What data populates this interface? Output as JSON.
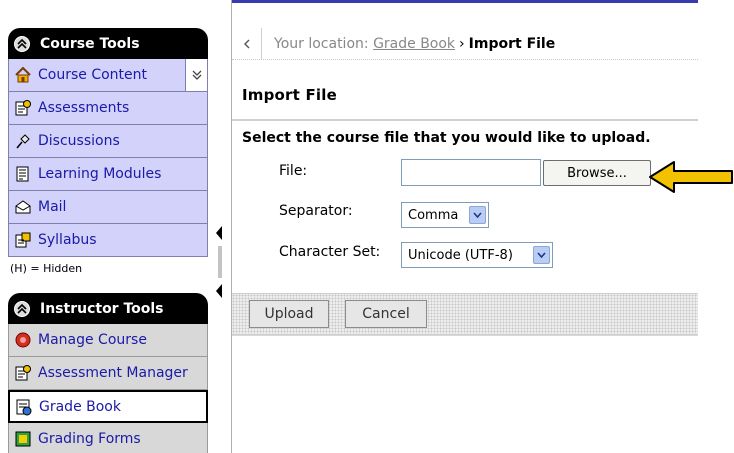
{
  "sidebar": {
    "course_tools": {
      "title": "Course Tools",
      "items": [
        {
          "label": "Course Content",
          "icon": "house-icon"
        },
        {
          "label": "Assessments",
          "icon": "assessments-icon"
        },
        {
          "label": "Discussions",
          "icon": "pushpin-icon"
        },
        {
          "label": "Learning Modules",
          "icon": "document-icon"
        },
        {
          "label": "Mail",
          "icon": "mail-icon"
        },
        {
          "label": "Syllabus",
          "icon": "syllabus-icon"
        }
      ],
      "hidden_note": "(H) = Hidden"
    },
    "instructor_tools": {
      "title": "Instructor Tools",
      "items": [
        {
          "label": "Manage Course",
          "icon": "manage-course-icon"
        },
        {
          "label": "Assessment Manager",
          "icon": "assessments-icon"
        },
        {
          "label": "Grade Book",
          "icon": "grade-book-icon",
          "selected": true
        },
        {
          "label": "Grading Forms",
          "icon": "grading-forms-icon"
        }
      ]
    }
  },
  "breadcrumb": {
    "prefix": "Your location:",
    "link": "Grade Book",
    "separator": "›",
    "current": "Import File"
  },
  "page": {
    "title": "Import File",
    "instruction": "Select the course file that you would like to upload."
  },
  "form": {
    "file_label": "File:",
    "file_value": "",
    "browse_label": "Browse...",
    "separator_label": "Separator:",
    "separator_value": "Comma",
    "charset_label": "Character Set:",
    "charset_value": "Unicode (UTF-8)"
  },
  "actions": {
    "upload_label": "Upload",
    "cancel_label": "Cancel"
  },
  "colors": {
    "course_item_bg": "#d2d2fa",
    "instructor_item_bg": "#d8d8d8",
    "header_bg": "#000000",
    "link_text": "#1a1aa8",
    "pointer_arrow": "#f2c200"
  }
}
